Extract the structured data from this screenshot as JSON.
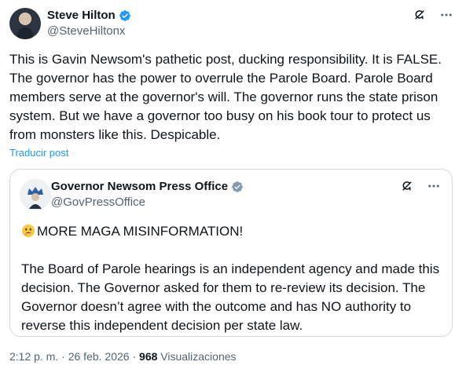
{
  "tweet": {
    "author": {
      "name": "Steve Hilton",
      "handle": "@SteveHiltonx"
    },
    "text": "This is Gavin Newsom's pathetic post, ducking responsibility. It is FALSE. The governor has the power to overrule the Parole Board. Parole Board members serve at the governor's will. The governor runs the state prison system. But we have a governor too busy on his book tour to protect us from monsters like this. Despicable.",
    "translate_label": "Traducir post",
    "time": "2:12 p. m.",
    "separator": " · ",
    "date": "26 feb. 2026",
    "views_count": "968",
    "views_label": "Visualizaciones"
  },
  "quote": {
    "author": {
      "name": "Governor Newsom Press Office",
      "handle": "@GovPressOffice"
    },
    "headline": "MORE MAGA MISINFORMATION!",
    "body": "The Board of Parole hearings is an independent agency and made this decision. The Governor asked for them to re-review its decision. The Governor doesn’t agree with the outcome and has NO authority to reverse this independent decision per state law."
  },
  "icons": {
    "verified": "verified-badge-icon",
    "grok": "grok-icon",
    "more": "more-options-icon",
    "emoji": "thinking-face-emoji"
  },
  "colors": {
    "accent": "#1d9bf0",
    "text": "#0f1419",
    "muted": "#536471",
    "border": "#cfd9de",
    "verified_gray": "#829aab"
  }
}
